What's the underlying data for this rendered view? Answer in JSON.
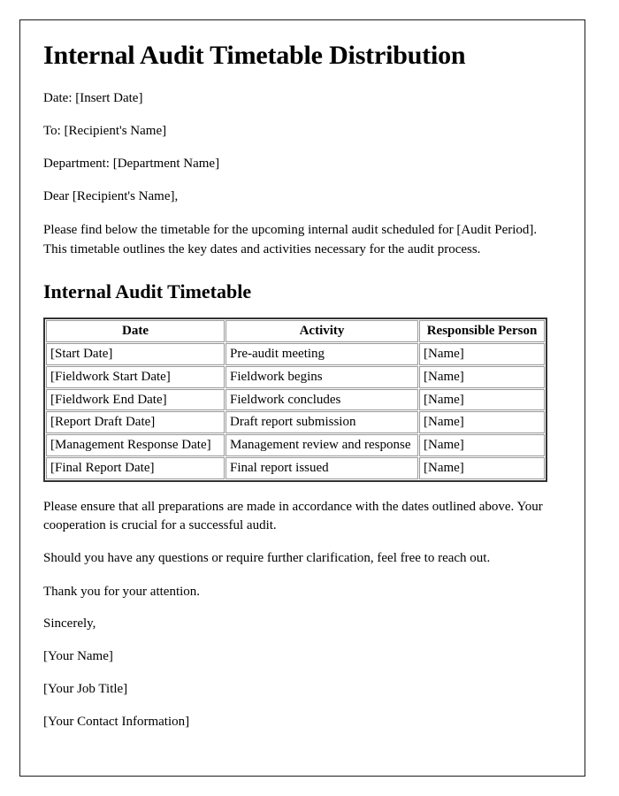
{
  "document": {
    "title": "Internal Audit Timetable Distribution",
    "header_fields": [
      "Date: [Insert Date]",
      "To: [Recipient's Name]",
      "Department: [Department Name]"
    ],
    "salutation": "Dear [Recipient's Name],",
    "intro_paragraph": "Please find below the timetable for the upcoming internal audit scheduled for [Audit Period]. This timetable outlines the key dates and activities necessary for the audit process.",
    "section_heading": "Internal Audit Timetable",
    "table": {
      "columns": [
        "Date",
        "Activity",
        "Responsible Person"
      ],
      "rows": [
        [
          "[Start Date]",
          "Pre-audit meeting",
          "[Name]"
        ],
        [
          "[Fieldwork Start Date]",
          "Fieldwork begins",
          "[Name]"
        ],
        [
          "[Fieldwork End Date]",
          "Fieldwork concludes",
          "[Name]"
        ],
        [
          "[Report Draft Date]",
          "Draft report submission",
          "[Name]"
        ],
        [
          "[Management Response Date]",
          "Management review and response",
          "[Name]"
        ],
        [
          "[Final Report Date]",
          "Final report issued",
          "[Name]"
        ]
      ]
    },
    "closing_paragraphs": [
      "Please ensure that all preparations are made in accordance with the dates outlined above. Your cooperation is crucial for a successful audit.",
      "Should you have any questions or require further clarification, feel free to reach out.",
      "Thank you for your attention."
    ],
    "signoff": "Sincerely,",
    "signature_block": [
      "[Your Name]",
      "[Your Job Title]",
      "[Your Contact Information]"
    ]
  },
  "colors": {
    "page_border": "#1c1c1c",
    "text": "#000000",
    "table_outer_border": "#333333",
    "table_cell_border": "#999999",
    "background": "#ffffff"
  }
}
